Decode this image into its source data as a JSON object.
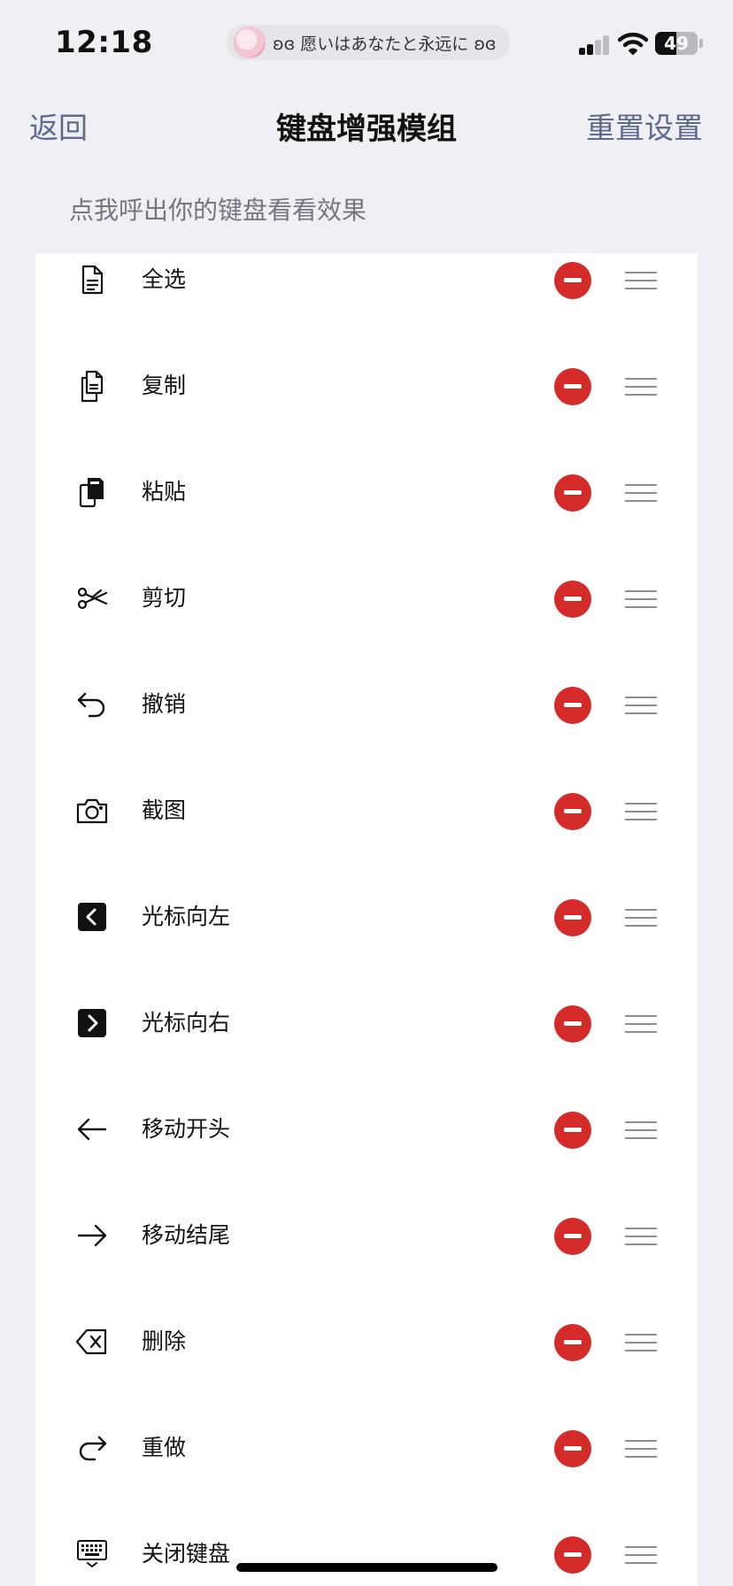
{
  "status_bar": {
    "time": "12:18",
    "now_playing": "ʚɞ 愿いはあなたと永远に ʚɞ",
    "battery_percent": "49",
    "battery_level": 0.49
  },
  "nav": {
    "back": "返回",
    "title": "键盘增强模组",
    "reset": "重置设置"
  },
  "hint": "点我呼出你的键盘看看效果",
  "items": [
    {
      "label": "全选",
      "icon": "document-icon"
    },
    {
      "label": "复制",
      "icon": "copy-icon"
    },
    {
      "label": "粘贴",
      "icon": "paste-icon"
    },
    {
      "label": "剪切",
      "icon": "scissors-icon"
    },
    {
      "label": "撤销",
      "icon": "undo-icon"
    },
    {
      "label": "截图",
      "icon": "camera-icon"
    },
    {
      "label": "光标向左",
      "icon": "chevron-left-icon"
    },
    {
      "label": "光标向右",
      "icon": "chevron-right-icon"
    },
    {
      "label": "移动开头",
      "icon": "arrow-left-icon"
    },
    {
      "label": "移动结尾",
      "icon": "arrow-right-icon"
    },
    {
      "label": "删除",
      "icon": "backspace-icon"
    },
    {
      "label": "重做",
      "icon": "redo-icon"
    },
    {
      "label": "关闭键盘",
      "icon": "keyboard-hide-icon"
    }
  ],
  "colors": {
    "accent": "#5c6a8d",
    "remove": "#d32a2a",
    "background": "#efeff4"
  }
}
